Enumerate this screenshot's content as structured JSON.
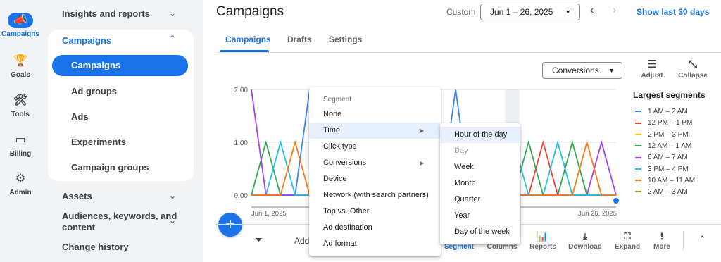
{
  "rail": {
    "items": [
      {
        "label": "Campaigns",
        "icon": "megaphone-icon",
        "glyph": "📣"
      },
      {
        "label": "Goals",
        "icon": "trophy-icon",
        "glyph": "🏆"
      },
      {
        "label": "Tools",
        "icon": "tools-icon",
        "glyph": "🛠"
      },
      {
        "label": "Billing",
        "icon": "credit-card-icon",
        "glyph": "▭"
      },
      {
        "label": "Admin",
        "icon": "gear-icon",
        "glyph": "⚙"
      }
    ]
  },
  "nav": {
    "insights": "Insights and reports",
    "campaigns_header": "Campaigns",
    "campaigns_sub": [
      "Campaigns",
      "Ad groups",
      "Ads",
      "Experiments",
      "Campaign groups"
    ],
    "assets": "Assets",
    "audiences": "Audiences, keywords, and",
    "audiences_line2": "content",
    "change_history": "Change history"
  },
  "header": {
    "title": "Campaigns",
    "custom_label": "Custom",
    "date_range": "Jun 1 – 26, 2025",
    "show_last": "Show last 30 days"
  },
  "tabs": [
    "Campaigns",
    "Drafts",
    "Settings"
  ],
  "controls": {
    "metric_select": "Conversions",
    "adjust": "Adjust",
    "collapse": "Collapse"
  },
  "legend": {
    "title": "Largest segments",
    "items": [
      {
        "label": "1 AM – 2 AM",
        "color": "#4285f4"
      },
      {
        "label": "12 PM – 1 PM",
        "color": "#ea4335"
      },
      {
        "label": "2 PM – 3 PM",
        "color": "#fbbc04"
      },
      {
        "label": "12 AM – 1 AM",
        "color": "#34a853"
      },
      {
        "label": "6 AM – 7 AM",
        "color": "#a142f4"
      },
      {
        "label": "3 PM – 4 PM",
        "color": "#24c1e0"
      },
      {
        "label": "10 AM – 11 AM",
        "color": "#fa7b17"
      },
      {
        "label": "2 AM – 3 AM",
        "color": "#9e9d24"
      }
    ]
  },
  "chart_data": {
    "type": "line",
    "x_start_label": "Jun 1, 2025",
    "x_end_label": "Jun 26, 2025",
    "yticks": [
      "2.00",
      "1.00",
      "0.00"
    ],
    "ylim": [
      0,
      2
    ],
    "x": [
      1,
      2,
      3,
      4,
      5,
      6,
      7,
      8,
      9,
      10,
      11,
      12,
      13,
      14,
      15,
      16,
      17,
      18,
      19,
      20,
      21,
      22,
      23,
      24,
      25,
      26
    ],
    "series": [
      {
        "name": "1 AM – 2 AM",
        "color": "#4285f4",
        "values": [
          0,
          0,
          0,
          0,
          2,
          0,
          0,
          0,
          0,
          0,
          0,
          0,
          0,
          0,
          2,
          0,
          0,
          0,
          0,
          0,
          0,
          0,
          0,
          0,
          0,
          0
        ]
      },
      {
        "name": "12 PM – 1 PM",
        "color": "#ea4335",
        "values": [
          0,
          0,
          0,
          0,
          0,
          0,
          0,
          0,
          0,
          0,
          0,
          0,
          0,
          0,
          0,
          0,
          0,
          0,
          0,
          0,
          1,
          0,
          0,
          0,
          0,
          0
        ]
      },
      {
        "name": "12 AM – 1 AM",
        "color": "#34a853",
        "values": [
          0,
          1,
          0,
          0,
          0,
          1,
          0,
          0,
          0,
          0,
          0,
          0,
          0,
          0,
          0,
          0,
          0,
          0,
          0,
          1,
          0,
          0,
          1,
          0,
          0,
          0
        ]
      },
      {
        "name": "6 AM – 7 AM",
        "color": "#a142f4",
        "values": [
          2,
          0,
          0,
          0,
          0,
          0,
          0,
          0,
          0,
          0,
          0,
          0,
          0,
          0,
          0,
          0,
          0,
          0,
          0,
          0,
          0,
          0,
          0,
          0,
          1,
          0
        ]
      },
      {
        "name": "3 PM – 4 PM",
        "color": "#24c1e0",
        "values": [
          0,
          0,
          1,
          0,
          0,
          0,
          0,
          0,
          0,
          0,
          0,
          0,
          0,
          0,
          0,
          0,
          0,
          0,
          1,
          0,
          0,
          1,
          0,
          0,
          0,
          0
        ]
      },
      {
        "name": "10 AM – 11 AM",
        "color": "#fa7b17",
        "values": [
          0,
          0,
          0,
          1,
          0,
          0,
          0,
          0,
          0,
          0,
          0,
          0,
          0,
          0,
          0,
          0,
          0,
          0,
          0,
          0,
          0,
          0,
          0,
          1,
          0,
          0
        ]
      }
    ]
  },
  "toolbar": {
    "add_label": "Add",
    "buttons": [
      {
        "label": "Segment",
        "icon": "segment-icon",
        "glyph": "≡"
      },
      {
        "label": "Columns",
        "icon": "columns-icon",
        "glyph": "▥"
      },
      {
        "label": "Reports",
        "icon": "reports-icon",
        "glyph": "📊"
      },
      {
        "label": "Download",
        "icon": "download-icon",
        "glyph": "⤓"
      },
      {
        "label": "Expand",
        "icon": "expand-icon",
        "glyph": "⛶"
      },
      {
        "label": "More",
        "icon": "more-icon",
        "glyph": "⋮"
      }
    ]
  },
  "segment_menu": {
    "header": "Segment",
    "items": [
      "None",
      "Time",
      "Click type",
      "Conversions",
      "Device",
      "Network (with search partners)",
      "Top vs. Other",
      "Ad destination",
      "Ad format"
    ]
  },
  "time_submenu": {
    "items": [
      "Hour of the day",
      "Day",
      "Week",
      "Month",
      "Quarter",
      "Year",
      "Day of the week"
    ]
  }
}
